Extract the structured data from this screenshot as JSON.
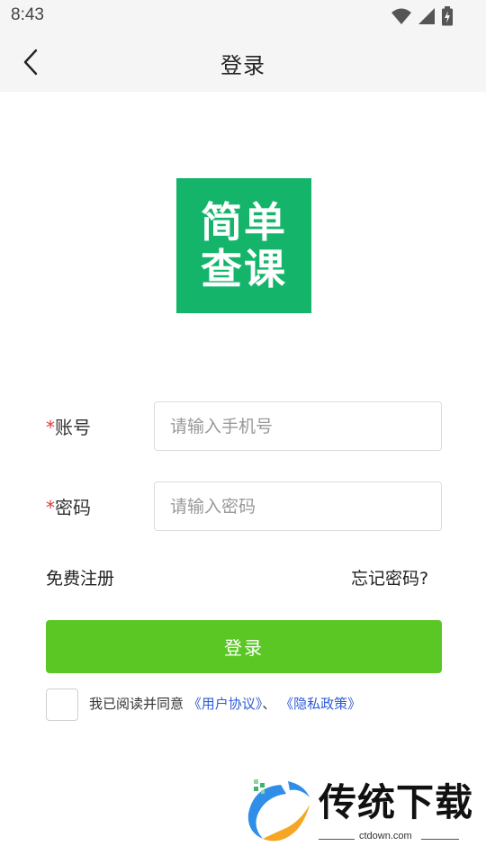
{
  "status_bar": {
    "time": "8:43",
    "icons": [
      "wifi-icon",
      "signal-icon",
      "battery-icon"
    ]
  },
  "header": {
    "title": "登录",
    "back_icon": "chevron-left-icon"
  },
  "logo": {
    "line1": "简单",
    "line2": "查课",
    "color": "#14b56b"
  },
  "form": {
    "required_mark": "*",
    "account_label": "账号",
    "account_placeholder": "请输入手机号",
    "account_value": "",
    "password_label": "密码",
    "password_placeholder": "请输入密码",
    "password_value": ""
  },
  "links": {
    "register": "免费注册",
    "forgot_password": "忘记密码?"
  },
  "login_button": {
    "label": "登录",
    "color": "#5ac724"
  },
  "agreement": {
    "checked": false,
    "prefix": "我已阅读并同意",
    "user_agreement": "《用户协议》",
    "separator": "、",
    "privacy_policy": "《隐私政策》",
    "link_color": "#2f5bd8"
  },
  "watermark": {
    "text": "传统下载",
    "url": "ctdown.com"
  }
}
